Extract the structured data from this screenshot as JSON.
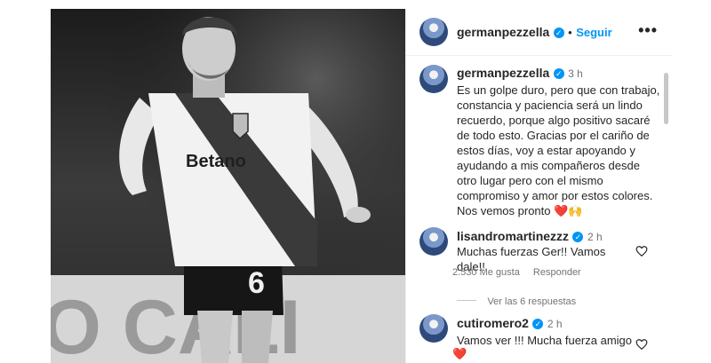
{
  "post": {
    "author": "germanpezzella",
    "follow_label": "Seguir",
    "separator": "•",
    "more_label": "•••",
    "jersey_text": "Betano",
    "jersey_number": "6",
    "background_text": "O CALI"
  },
  "caption": {
    "author": "germanpezzella",
    "time": "3 h",
    "text": "Es un golpe duro, pero que con trabajo,\nconstancia y paciencia será un lindo\nrecuerdo, porque algo positivo sacaré\nde todo esto. Gracias por el cariño de\nestos días, voy a estar apoyando y\nayudando a mis compañeros desde\notro lugar pero con el mismo\ncompromiso y amor por estos colores.\nNos vemos pronto ❤️🙌"
  },
  "comments": [
    {
      "author": "lisandromartinezzz",
      "time": "2 h",
      "text": "Muchas fuerzas Ger!! Vamos dale!!",
      "likes": "2.530 Me gusta",
      "reply_label": "Responder",
      "view_replies": "Ver las 6 respuestas"
    },
    {
      "author": "cutiromero2",
      "time": "2 h",
      "text": "Vamos ver !!! Mucha fuerza amigo",
      "emoji": "❤️"
    }
  ],
  "colors": {
    "accent": "#0095f6",
    "secondary_text": "#737373",
    "heart": "#ed4956"
  },
  "icons": [
    "verified-icon",
    "heart-outline-icon",
    "more-options-icon"
  ]
}
